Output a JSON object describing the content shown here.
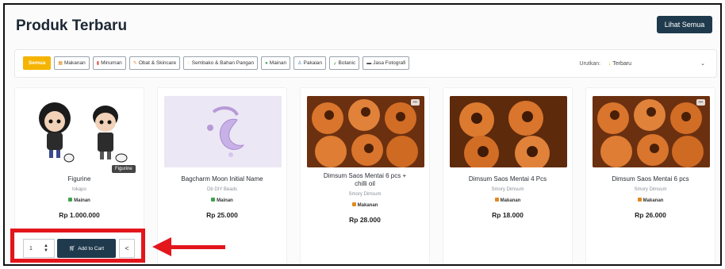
{
  "header": {
    "title": "Produk Terbaru",
    "see_all_label": "Lihat Semua"
  },
  "filters": {
    "chips": [
      {
        "label": "Semua",
        "icon": "",
        "active": true
      },
      {
        "label": "Makanan",
        "icon": "food-icon"
      },
      {
        "label": "Minuman",
        "icon": "drink-icon"
      },
      {
        "label": "Obat & Skincare",
        "icon": "medicine-icon"
      },
      {
        "label": "Sembako & Bahan Pangan",
        "icon": "groceries-icon"
      },
      {
        "label": "Mainan",
        "icon": "toy-icon"
      },
      {
        "label": "Pakaian",
        "icon": "clothes-icon"
      },
      {
        "label": "Botanic",
        "icon": "plant-icon"
      },
      {
        "label": "Jasa Fotografi",
        "icon": "camera-icon"
      }
    ],
    "sort_label": "Urutkan:",
    "sort_value": "Terbaru"
  },
  "products": [
    {
      "name": "Figurine",
      "seller": "lokapo",
      "category": "Mainan",
      "price": "Rp 1.000.000",
      "tooltip": "Figurine"
    },
    {
      "name": "Bagcharm Moon Initial Name",
      "seller": "Db DIY Beads",
      "category": "Mainan",
      "price": "Rp 25.000"
    },
    {
      "name": "Dimsum Saos Mentai 6 pcs + chilli oil",
      "seller": "Smory Dimsum",
      "category": "Makanan",
      "price": "Rp 28.000"
    },
    {
      "name": "Dimsum Saos Mentai 4 Pcs",
      "seller": "Smory Dimsum",
      "category": "Makanan",
      "price": "Rp 18.000"
    },
    {
      "name": "Dimsum Saos Mentai 6 pcs",
      "seller": "Smory Dimsum",
      "category": "Makanan",
      "price": "Rp 26.000"
    }
  ],
  "cart": {
    "quantity": "1",
    "add_label": "Add to Cart"
  },
  "colors": {
    "accent": "#f5b400",
    "primary": "#1f3a4d",
    "highlight": "#e3161c"
  }
}
